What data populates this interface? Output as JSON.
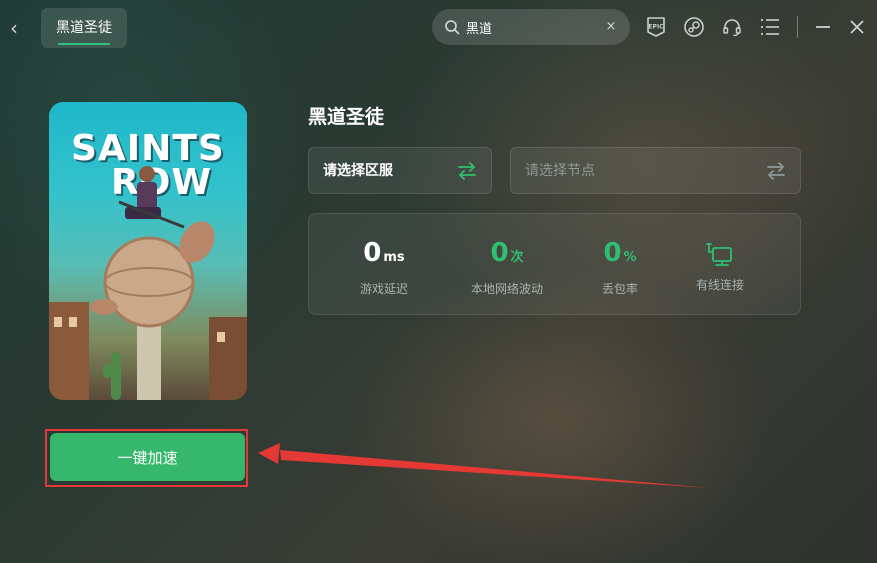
{
  "topbar": {
    "tab_label": "黑道圣徒",
    "search": {
      "value": "黑道",
      "clear_symbol": "×"
    },
    "icons": [
      "back-icon",
      "epic-games-icon",
      "steam-icon",
      "headset-icon",
      "menu-list-icon",
      "minimize-icon",
      "close-icon"
    ]
  },
  "cover": {
    "line1": "SAINTS",
    "line2": "ROW"
  },
  "game": {
    "name": "黑道圣徒",
    "region_select": "请选择区服",
    "node_select": "请选择节点"
  },
  "stats": {
    "latency": {
      "value": "0",
      "unit": "ms",
      "label": "游戏延迟"
    },
    "jitter": {
      "value": "0",
      "unit": "次",
      "label": "本地网络波动"
    },
    "packet_loss": {
      "value": "0",
      "unit": "%",
      "label": "丢包率"
    },
    "connection": {
      "label": "有线连接"
    }
  },
  "action": {
    "accelerate_label": "一键加速"
  },
  "colors": {
    "accent": "#35b86b",
    "stat_green": "#2fbf71",
    "annotation_red": "#e53935"
  }
}
